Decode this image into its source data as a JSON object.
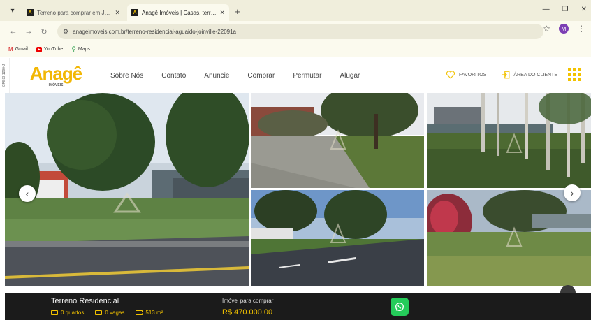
{
  "browser": {
    "tabs": [
      {
        "title": "Terreno para comprar em Joinv...",
        "active": false
      },
      {
        "title": "Anagê Imóveis | Casas, terrenos...",
        "active": true
      }
    ],
    "url": "anageimoveis.com.br/terreno-residencial-aguaido-joinville-22091a",
    "bookmarks": [
      {
        "label": "Gmail",
        "icon": "gmail-icon"
      },
      {
        "label": "YouTube",
        "icon": "youtube-icon"
      },
      {
        "label": "Maps",
        "icon": "maps-icon"
      }
    ],
    "profile_initial": "M"
  },
  "site": {
    "side_tag": "CRECI 1290-J",
    "logo_text": "Anagê",
    "logo_sub": "IMÓVEIS",
    "brand_color": "#f2b705",
    "nav": [
      "Sobre Nós",
      "Contato",
      "Anuncie",
      "Comprar",
      "Permutar",
      "Alugar"
    ],
    "favorites_label": "FAVORITOS",
    "client_area_label": "ÁREA DO CLIENTE"
  },
  "listing": {
    "title": "Terreno Residencial",
    "bedrooms": "0 quartos",
    "parking": "0 vagas",
    "area": "513 m²",
    "price_label": "Imóvel para comprar",
    "price": "R$ 470.000,00"
  },
  "gallery": {
    "prev_icon": "chevron-left-icon",
    "next_icon": "chevron-right-icon",
    "photo_count": 5
  }
}
